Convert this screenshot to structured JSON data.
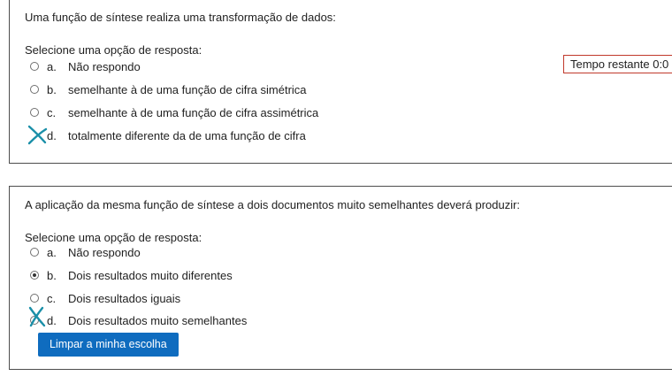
{
  "question1": {
    "text": "Uma função de síntese realiza uma transformação de dados:",
    "prompt": "Selecione uma opção de resposta:",
    "options": [
      {
        "letter": "a.",
        "text": "Não respondo",
        "selected": false
      },
      {
        "letter": "b.",
        "text": "semelhante à de uma função de cifra simétrica",
        "selected": false
      },
      {
        "letter": "c.",
        "text": "semelhante à de uma função de cifra assimétrica",
        "selected": false
      },
      {
        "letter": "d.",
        "text": "totalmente diferente da de uma função de cifra",
        "selected": false
      }
    ]
  },
  "timer": {
    "label": "Tempo restante 0:0"
  },
  "question2": {
    "text": "A aplicação da mesma função de síntese a dois documentos muito semelhantes deverá produzir:",
    "prompt": "Selecione uma opção de resposta:",
    "options": [
      {
        "letter": "a.",
        "text": "Não respondo",
        "selected": false
      },
      {
        "letter": "b.",
        "text": "Dois resultados muito diferentes",
        "selected": true
      },
      {
        "letter": "c.",
        "text": "Dois resultados iguais",
        "selected": false
      },
      {
        "letter": "d.",
        "text": "Dois resultados muito semelhantes",
        "selected": false
      }
    ],
    "clear_button": "Limpar a minha escolha"
  },
  "colors": {
    "annotation_mark": "#1a8fa8",
    "button_bg": "#0f6cbf",
    "timer_border": "#c0392b"
  }
}
